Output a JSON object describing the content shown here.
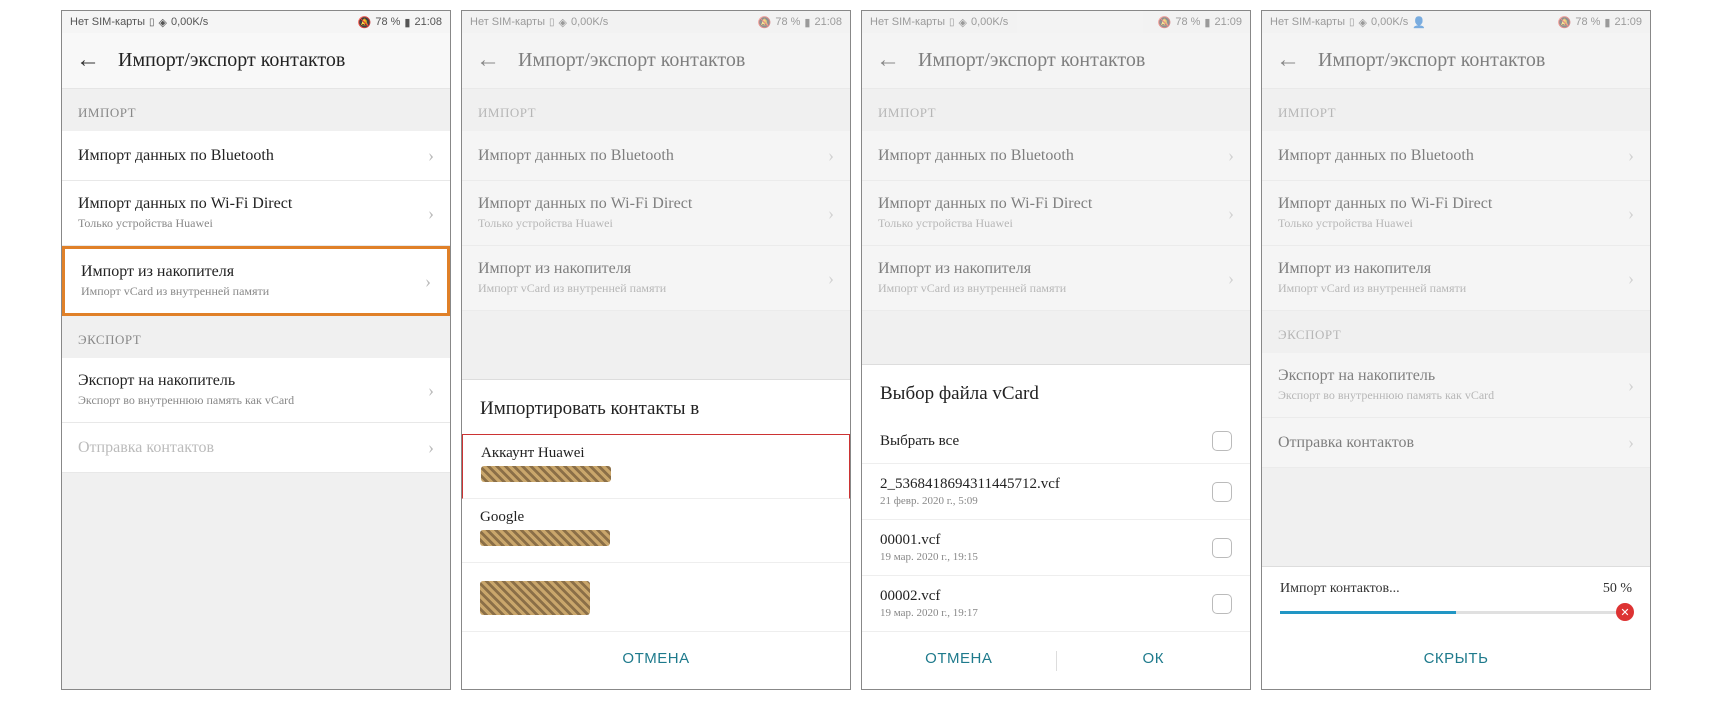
{
  "status": {
    "sim": "Нет SIM-карты",
    "speed": "0,00K/s",
    "battery": "78 %",
    "time1": "21:08",
    "time2": "21:09"
  },
  "header": {
    "title": "Импорт/экспорт контактов"
  },
  "sections": {
    "import": "ИМПОРТ",
    "export": "ЭКСПОРТ"
  },
  "items": {
    "bluetooth": "Импорт данных по Bluetooth",
    "wifi": "Импорт данных по Wi-Fi Direct",
    "wifi_sub": "Только устройства Huawei",
    "storage": "Импорт из накопителя",
    "storage_sub": "Импорт vCard из внутренней памяти",
    "export_storage": "Экспорт на накопитель",
    "export_storage_sub": "Экспорт во внутреннюю память как vCard",
    "send": "Отправка контактов"
  },
  "sheet2": {
    "title": "Импортировать контакты в",
    "opt1": "Аккаунт Huawei",
    "opt2": "Google",
    "cancel": "ОТМЕНА"
  },
  "sheet3": {
    "title": "Выбор файла vCard",
    "select_all": "Выбрать все",
    "f1": "2_536841869431144571​2.vcf",
    "f1d": "21 февр. 2020 г., 5:09",
    "f2": "00001.vcf",
    "f2d": "19 мар. 2020 г., 19:15",
    "f3": "00002.vcf",
    "f3d": "19 мар. 2020 г., 19:17",
    "cancel": "ОТМЕНА",
    "ok": "ОК"
  },
  "progress": {
    "label": "Импорт контактов...",
    "pct": "50 %",
    "hide": "СКРЫТЬ"
  }
}
